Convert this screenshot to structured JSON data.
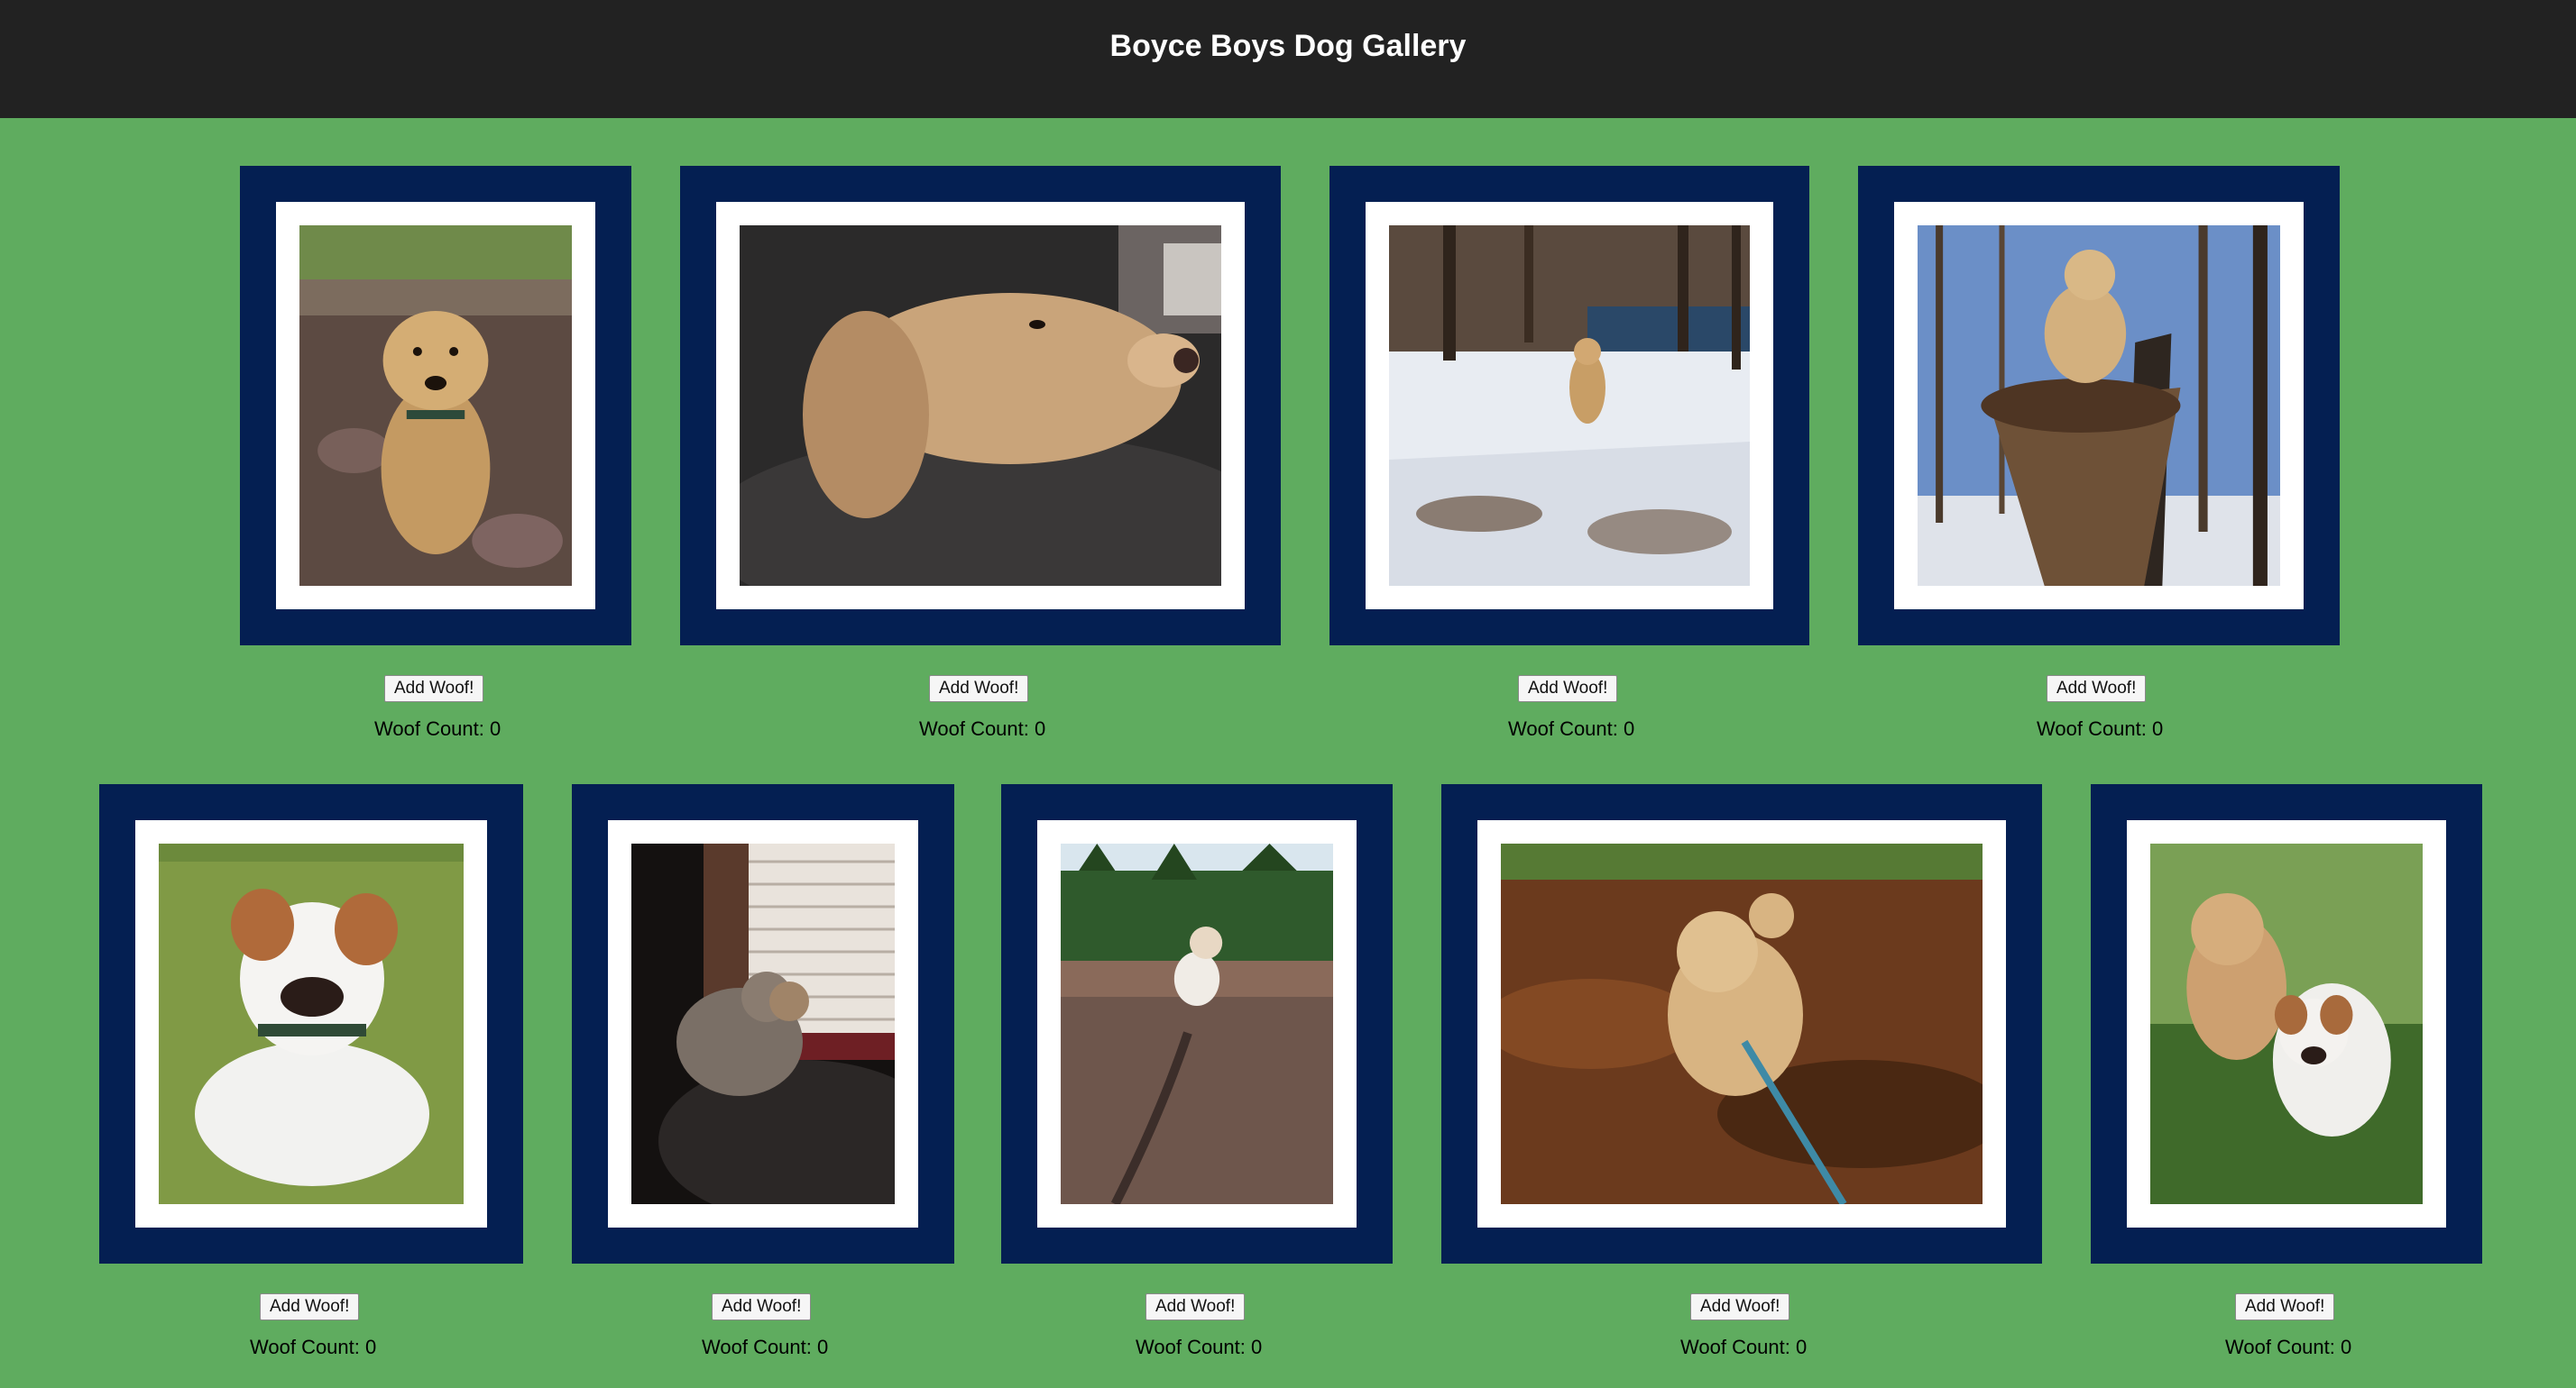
{
  "page": {
    "title": "Boyce Boys Dog Gallery"
  },
  "colors": {
    "header_bg": "#222222",
    "page_bg": "#5fac5f",
    "frame": "#041f52",
    "mat": "#ffffff"
  },
  "gallery": {
    "cards": [
      {
        "photo_name": "terrier-in-dirt-yard-photo",
        "button_label": "Add Woof!",
        "count_label": "Woof Count: 0"
      },
      {
        "photo_name": "lab-resting-head-photo",
        "button_label": "Add Woof!",
        "count_label": "Woof Count: 0"
      },
      {
        "photo_name": "dog-in-snowy-woods-photo",
        "button_label": "Add Woof!",
        "count_label": "Woof Count: 0"
      },
      {
        "photo_name": "dog-on-tree-stump-photo",
        "button_label": "Add Woof!",
        "count_label": "Woof Count: 0"
      },
      {
        "photo_name": "jack-russell-in-grass-photo",
        "button_label": "Add Woof!",
        "count_label": "Woof Count: 0"
      },
      {
        "photo_name": "dogs-at-window-photo",
        "button_label": "Add Woof!",
        "count_label": "Woof Count: 0"
      },
      {
        "photo_name": "dog-on-rocks-by-forest-photo",
        "button_label": "Add Woof!",
        "count_label": "Woof Count: 0"
      },
      {
        "photo_name": "dog-in-creek-photo",
        "button_label": "Add Woof!",
        "count_label": "Woof Count: 0"
      },
      {
        "photo_name": "two-dogs-in-grass-photo",
        "button_label": "Add Woof!",
        "count_label": "Woof Count: 0"
      }
    ]
  }
}
